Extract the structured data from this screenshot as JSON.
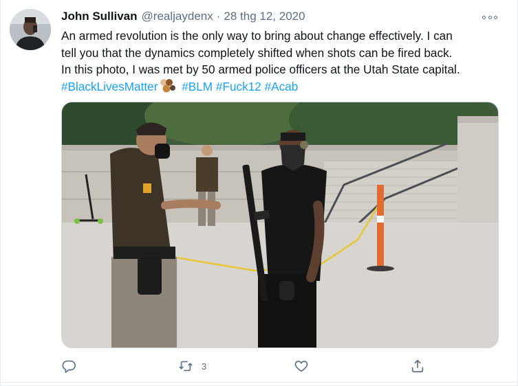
{
  "tweet": {
    "author": {
      "name": "John Sullivan",
      "handle": "@realjaydenx",
      "avatar_icon": "user-avatar"
    },
    "separator": "·",
    "date": "28 thg 12, 2020",
    "text": {
      "line1": "An armed revolution is the only way to bring about change effectively. I can",
      "line2": "tell you that the dynamics completely shifted when shots can be fired back.",
      "line3": "In this photo, I was met by 50 armed police officers at the Utah State capital.",
      "hashtags": [
        "#BlackLivesMatter",
        "#BLM",
        "#Fuck12",
        "#Acab"
      ],
      "emoji": "raised-fists-skin-tones-emoji"
    },
    "media": {
      "description_icon": "photo"
    },
    "actions": {
      "reply_icon": "reply-icon",
      "retweet_icon": "retweet-icon",
      "retweet_count": "3",
      "like_icon": "heart-icon",
      "share_icon": "share-icon"
    }
  },
  "colors": {
    "link": "#1da1f2",
    "secondary_text": "#5b7083",
    "primary_text": "#0f1419",
    "border": "#e6ecf0"
  }
}
